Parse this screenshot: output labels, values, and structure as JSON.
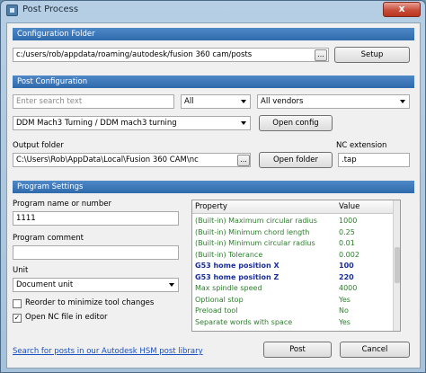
{
  "window": {
    "title": "Post Process",
    "close_label": "x"
  },
  "config_folder": {
    "header": "Configuration Folder",
    "path": "c:/users/rob/appdata/roaming/autodesk/fusion 360 cam/posts",
    "browse_label": "...",
    "setup_label": "Setup"
  },
  "post_config": {
    "header": "Post Configuration",
    "search_placeholder": "Enter search text",
    "filter_all": "All",
    "vendor_filter": "All vendors",
    "selected_post": "DDM Mach3 Turning / DDM mach3 turning",
    "open_config_label": "Open config"
  },
  "output": {
    "folder_label": "Output folder",
    "folder_path": "C:\\Users\\Rob\\AppData\\Local\\Fusion 360 CAM\\nc",
    "browse_label": "...",
    "open_folder_label": "Open folder",
    "nc_ext_label": "NC extension",
    "nc_ext_value": ".tap"
  },
  "program": {
    "header": "Program Settings",
    "name_label": "Program name or number",
    "name_value": "1111",
    "comment_label": "Program comment",
    "comment_value": "",
    "unit_label": "Unit",
    "unit_value": "Document unit",
    "reorder_label": "Reorder to minimize tool changes",
    "reorder_checked": false,
    "open_nc_label": "Open NC file in editor",
    "open_nc_checked": true,
    "check_mark": "✓"
  },
  "properties": {
    "col_property": "Property",
    "col_value": "Value",
    "rows": [
      {
        "property": "(Built-in) Maximum circular radius",
        "value": "1000",
        "bold": false
      },
      {
        "property": "(Built-in) Minimum chord length",
        "value": "0.25",
        "bold": false
      },
      {
        "property": "(Built-in) Minimum circular radius",
        "value": "0.01",
        "bold": false
      },
      {
        "property": "(Built-in) Tolerance",
        "value": "0.002",
        "bold": false
      },
      {
        "property": "G53 home position X",
        "value": "100",
        "bold": true
      },
      {
        "property": "G53 home position Z",
        "value": "220",
        "bold": true
      },
      {
        "property": "Max spindle speed",
        "value": "4000",
        "bold": false
      },
      {
        "property": "Optional stop",
        "value": "Yes",
        "bold": false
      },
      {
        "property": "Preload tool",
        "value": "No",
        "bold": false
      },
      {
        "property": "Separate words with space",
        "value": "Yes",
        "bold": false
      }
    ]
  },
  "footer": {
    "search_link": "Search for posts in our Autodesk HSM post library",
    "post_label": "Post",
    "cancel_label": "Cancel"
  }
}
